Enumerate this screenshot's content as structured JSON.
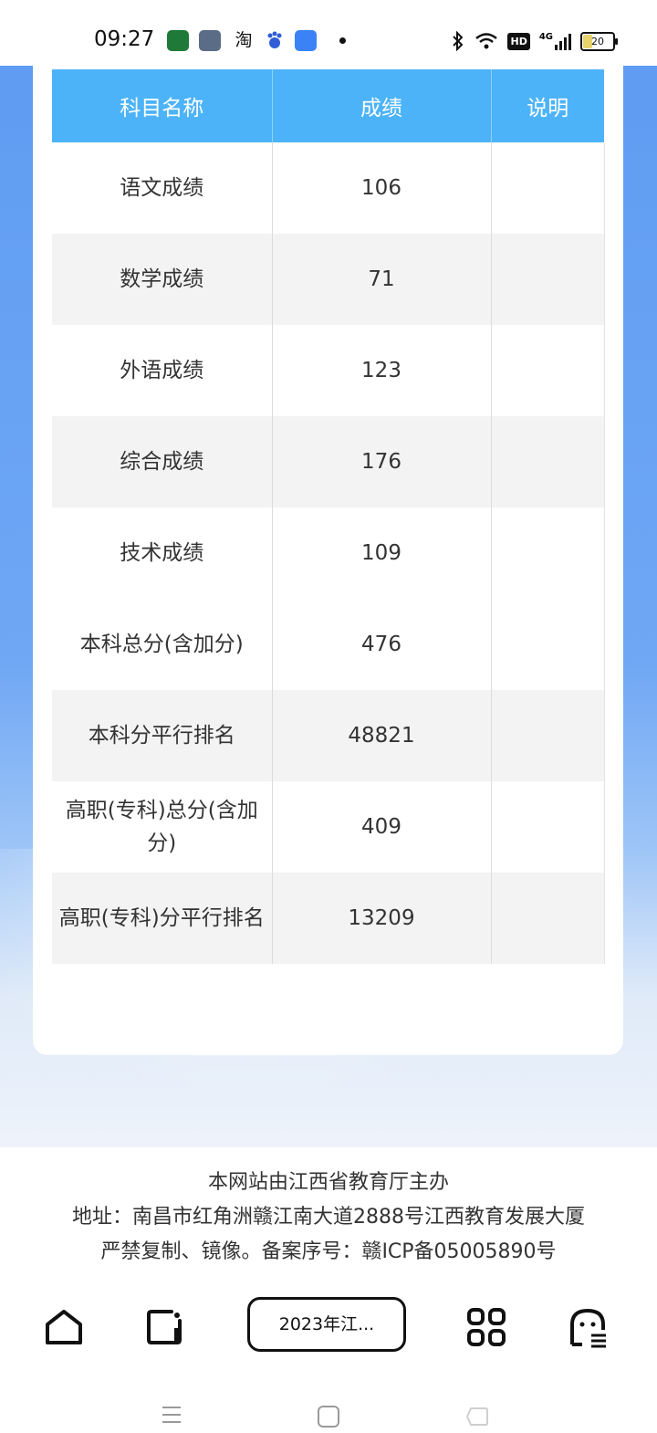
{
  "status_bar": {
    "time": "09:27",
    "apps": [
      "oppo-app-icon",
      "photo-app-icon",
      "taobao-icon",
      "baidu-icon",
      "chat-app-icon"
    ],
    "taobao_label": "淘",
    "hd_label": "HD",
    "network_label": "4G",
    "battery_level": "20"
  },
  "table": {
    "headers": [
      "科目名称",
      "成绩",
      "说明"
    ],
    "rows": [
      {
        "subject": "语文成绩",
        "score": "106",
        "note": ""
      },
      {
        "subject": "数学成绩",
        "score": "71",
        "note": ""
      },
      {
        "subject": "外语成绩",
        "score": "123",
        "note": ""
      },
      {
        "subject": "综合成绩",
        "score": "176",
        "note": ""
      },
      {
        "subject": "技术成绩",
        "score": "109",
        "note": ""
      },
      {
        "subject": "本科总分(含加分)",
        "score": "476",
        "note": ""
      },
      {
        "subject": "本科分平行排名",
        "score": "48821",
        "note": ""
      },
      {
        "subject": "高职(专科)总分(含加分)",
        "score": "409",
        "note": ""
      },
      {
        "subject": "高职(专科)分平行排名",
        "score": "13209",
        "note": ""
      }
    ]
  },
  "footer": {
    "line1": "本网站由江西省教育厅主办",
    "line2": "地址：南昌市红角洲赣江南大道2888号江西教育发展大厦",
    "line3": "严禁复制、镜像。备案序号：赣ICP备05005890号"
  },
  "browser_nav": {
    "url_label": "2023年江..."
  },
  "colors": {
    "header_blue": "#4db3f8",
    "page_blue": "#5f9cf2"
  }
}
